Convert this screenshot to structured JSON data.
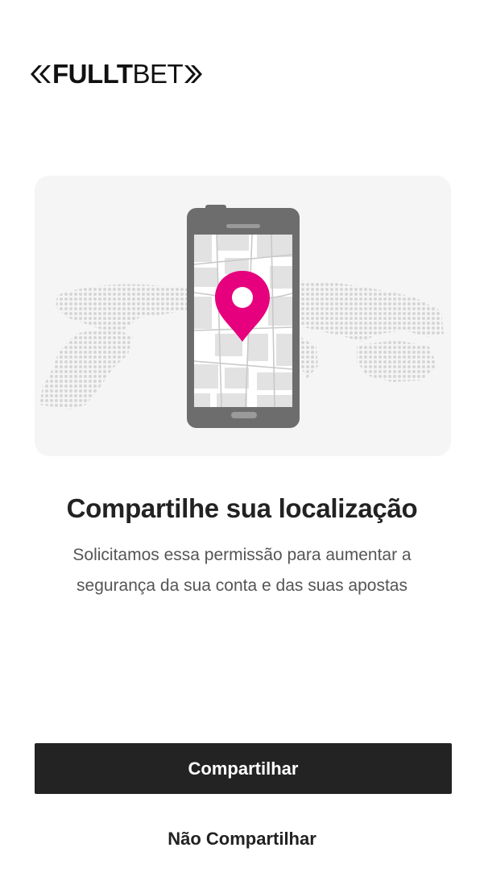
{
  "brand": {
    "name_bold": "FULLT",
    "name_light": "BET",
    "logo_icon": "double-chevron"
  },
  "hero": {
    "illustration": "phone-map-pin-on-world-map",
    "pin_color": "#e6007e",
    "phone_color": "#6d6d6d"
  },
  "content": {
    "title": "Compartilhe sua localização",
    "subtitle_line1": "Solicitamos essa permissão para aumentar a",
    "subtitle_line2": "segurança da sua conta e das suas apostas"
  },
  "actions": {
    "share_label": "Compartilhar",
    "dont_share_label": "Não Compartilhar"
  }
}
